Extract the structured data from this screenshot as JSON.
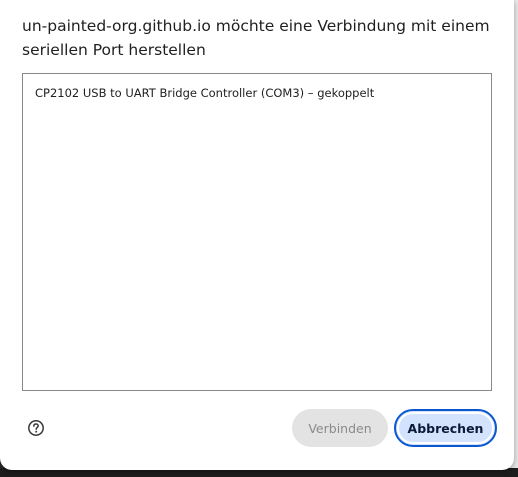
{
  "dialog": {
    "title": "un-painted-org.github.io möchte eine Verbindung mit einem seriellen Port herstellen",
    "devices": [
      {
        "label": "CP2102 USB to UART Bridge Controller (COM3) – gekoppelt"
      }
    ],
    "help_icon": "help-circle-icon",
    "buttons": {
      "connect_label": "Verbinden",
      "cancel_label": "Abbrechen"
    }
  },
  "colors": {
    "accent": "#0b57d0",
    "cancel_bg": "#d3e3fd",
    "disabled_bg": "#e3e3e3",
    "disabled_text": "#8b8b8b"
  }
}
